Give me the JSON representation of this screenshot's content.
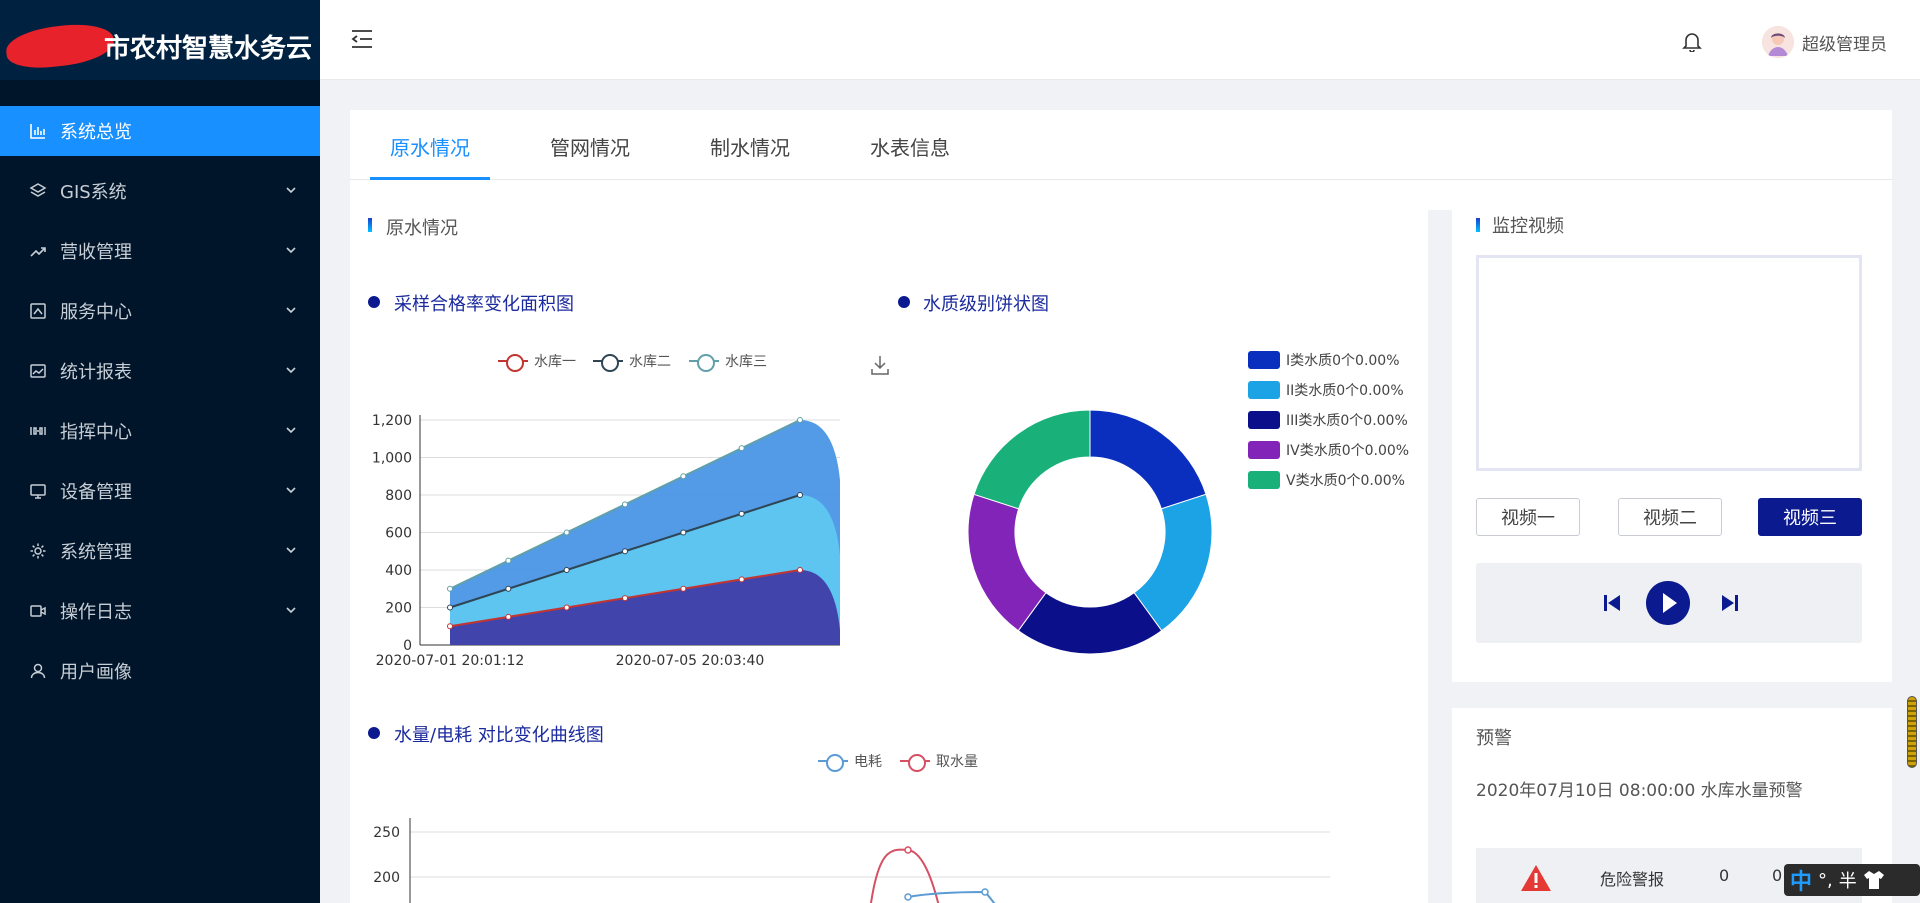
{
  "sidebar": {
    "logo_text": "市农村智慧水务云",
    "items": [
      {
        "label": "系统总览",
        "icon": "bar-chart-icon",
        "active": true,
        "has_arrow": false
      },
      {
        "label": "GIS系统",
        "icon": "gis-icon",
        "active": false,
        "has_arrow": true
      },
      {
        "label": "营收管理",
        "icon": "trend-icon",
        "active": false,
        "has_arrow": true
      },
      {
        "label": "服务中心",
        "icon": "service-icon",
        "active": false,
        "has_arrow": true
      },
      {
        "label": "统计报表",
        "icon": "report-icon",
        "active": false,
        "has_arrow": true
      },
      {
        "label": "指挥中心",
        "icon": "command-icon",
        "active": false,
        "has_arrow": true
      },
      {
        "label": "设备管理",
        "icon": "monitor-icon",
        "active": false,
        "has_arrow": true
      },
      {
        "label": "系统管理",
        "icon": "gear-icon",
        "active": false,
        "has_arrow": true
      },
      {
        "label": "操作日志",
        "icon": "video-log-icon",
        "active": false,
        "has_arrow": true
      },
      {
        "label": "用户画像",
        "icon": "user-icon",
        "active": false,
        "has_arrow": false
      }
    ]
  },
  "header": {
    "user_name": "超级管理员"
  },
  "tabs": [
    {
      "label": "原水情况",
      "active": true
    },
    {
      "label": "管网情况",
      "active": false
    },
    {
      "label": "制水情况",
      "active": false
    },
    {
      "label": "水表信息",
      "active": false
    }
  ],
  "main": {
    "section_title": "原水情况",
    "area_chart_title": "采样合格率变化面积图",
    "pie_chart_title": "水质级别饼状图",
    "line_chart_title": "水量/电耗 对比变化曲线图"
  },
  "colors": {
    "accent": "#1890ff",
    "sidebar_bg": "#001529",
    "dark_blue": "#0b1b8f"
  },
  "chart_data": [
    {
      "type": "area",
      "title": "采样合格率变化面积图",
      "x_ticks": [
        "2020-07-01 20:01:12",
        "2020-07-05 20:03:40"
      ],
      "ylim": [
        0,
        1200
      ],
      "y_ticks": [
        "0",
        "200",
        "400",
        "600",
        "800",
        "1,000",
        "1,200"
      ],
      "legend": [
        "水库一",
        "水库二",
        "水库三"
      ],
      "series": [
        {
          "name": "水库一",
          "color": "#c23531",
          "values": [
            100,
            150,
            200,
            250,
            300,
            350,
            400
          ]
        },
        {
          "name": "水库二",
          "color": "#2f4554",
          "values": [
            200,
            300,
            400,
            500,
            600,
            700,
            800
          ]
        },
        {
          "name": "水库三",
          "color": "#61a0a8",
          "values": [
            300,
            450,
            600,
            750,
            900,
            1050,
            1200
          ]
        }
      ]
    },
    {
      "type": "pie",
      "title": "水质级别饼状图",
      "labels": [
        "I类水质0个0.00%",
        "II类水质0个0.00%",
        "III类水质0个0.00%",
        "IV类水质0个0.00%",
        "V类水质0个0.00%"
      ],
      "values": [
        20,
        20,
        20,
        20,
        20
      ],
      "colors": [
        "#0a2fbf",
        "#1ba3e6",
        "#0b0f8a",
        "#8324b8",
        "#1ab07a"
      ]
    },
    {
      "type": "line",
      "title": "水量/电耗 对比变化曲线图",
      "legend": [
        "电耗",
        "取水量"
      ],
      "y_ticks": [
        "250",
        "200"
      ],
      "series": [
        {
          "name": "电耗",
          "color": "#5b9bd5"
        },
        {
          "name": "取水量",
          "color": "#d64f63"
        }
      ]
    }
  ],
  "video": {
    "title": "监控视频",
    "buttons": [
      {
        "label": "视频一",
        "active": false
      },
      {
        "label": "视频二",
        "active": false
      },
      {
        "label": "视频三",
        "active": true
      }
    ]
  },
  "warning": {
    "title": "预警",
    "text": "2020年07月10日 08:00:00 水库水量预警",
    "alert_label": "危险警报",
    "alert_count": "0",
    "alert_count2": "0"
  },
  "ime": {
    "zh": "中",
    "punct": "°,",
    "half": "半"
  }
}
